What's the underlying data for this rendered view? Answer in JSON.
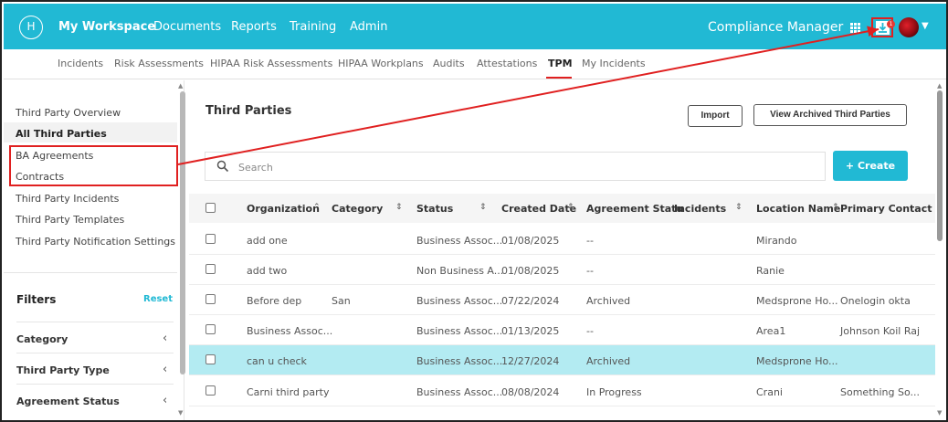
{
  "topnav": {
    "logo": "H",
    "items": [
      "My Workspace",
      "Documents",
      "Reports",
      "Training",
      "Admin"
    ],
    "app_title": "Compliance Manager",
    "download_badge": "1"
  },
  "subnav": [
    "Incidents",
    "Risk Assessments",
    "HIPAA Risk Assessments",
    "HIPAA Workplans",
    "Audits",
    "Attestations",
    "TPM",
    "My Incidents"
  ],
  "sidebar": {
    "links": [
      "Third Party Overview",
      "All Third Parties",
      "BA Agreements",
      "Contracts",
      "Third Party Incidents",
      "Third Party Templates",
      "Third Party Notification Settings"
    ],
    "filters_title": "Filters",
    "reset_label": "Reset",
    "filters": [
      "Category",
      "Third Party Type",
      "Agreement Status"
    ]
  },
  "main": {
    "title": "Third Parties",
    "import_label": "Import",
    "archived_label": "View Archived Third Parties",
    "create_label": "+ Create",
    "search_placeholder": "Search"
  },
  "table": {
    "columns": [
      "Organization",
      "Category",
      "Status",
      "Created Date",
      "Agreement Statu",
      "Incidents",
      "Location Name",
      "Primary Contact"
    ],
    "rows": [
      [
        "add one",
        "",
        "Business Assoc...",
        "01/08/2025",
        "--",
        "Mirando",
        ""
      ],
      [
        "add two",
        "",
        "Non Business A...",
        "01/08/2025",
        "--",
        "Ranie",
        ""
      ],
      [
        "Before dep",
        "San",
        "Business Assoc...",
        "07/22/2024",
        "Archived",
        "Medsprone Ho...",
        "Onelogin okta"
      ],
      [
        "Business Assoc...",
        "",
        "Business Assoc...",
        "01/13/2025",
        "--",
        "Area1",
        "Johnson Koil Raj"
      ],
      [
        "can u check",
        "",
        "Business Assoc...",
        "12/27/2024",
        "Archived",
        "Medsprone Ho...",
        ""
      ],
      [
        "Carni third party",
        "",
        "Business Assoc...",
        "08/08/2024",
        "In Progress",
        "Crani",
        "Something So..."
      ]
    ]
  },
  "colors": {
    "brand": "#21b9d4",
    "callout": "#e02020",
    "highlight_row": "#b3ebf2"
  }
}
